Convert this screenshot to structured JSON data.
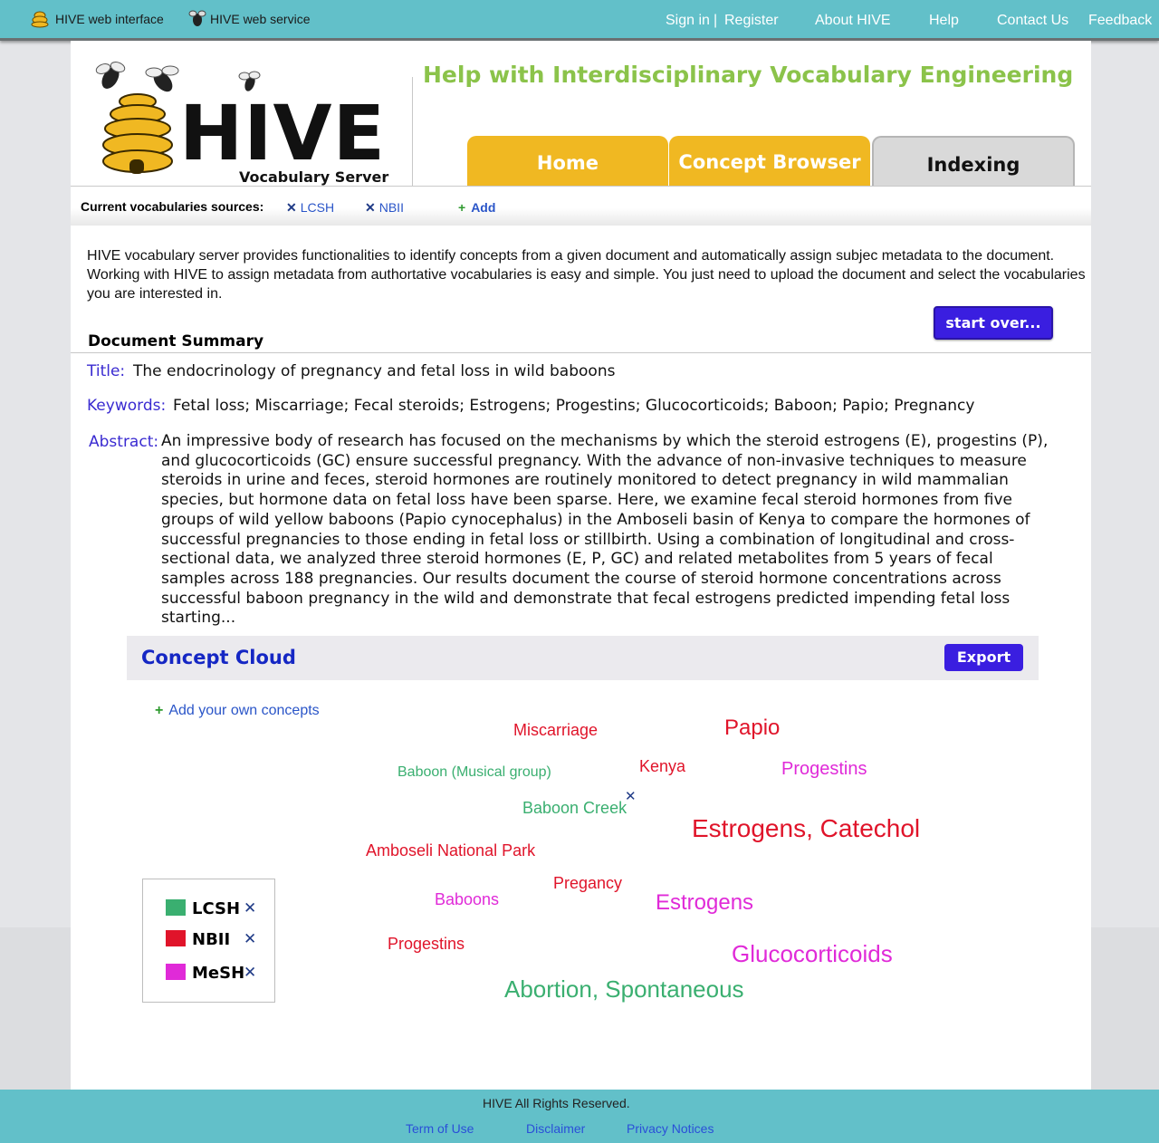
{
  "topbar": {
    "left_links": [
      "HIVE web interface",
      "HIVE web service"
    ],
    "sign_in": "Sign in",
    "sep": "|",
    "register": "Register",
    "about": "About HIVE",
    "help": "Help",
    "contact": "Contact Us",
    "feedback": "Feedback"
  },
  "header": {
    "logo_word": "HIVE",
    "logo_sub": "Vocabulary Server",
    "tagline": "Help with Interdisciplinary Vocabulary Engineering",
    "tabs": [
      "Home",
      "Concept Browser",
      "Indexing"
    ],
    "active_tab": "Indexing"
  },
  "sources": {
    "label": "Current vocabularies sources:",
    "items": [
      "LCSH",
      "NBII"
    ],
    "add": "Add",
    "remove_glyph": "✕",
    "add_glyph": "+"
  },
  "intro": "HIVE vocabulary server provides functionalities to identify concepts from a given document and automatically assign subjec metadata to the document. Working with HIVE to assign metadata from authortative vocabularies is easy and simple. You just need to upload the document and select the vocabularies you are interested in.",
  "start_over": "start over...",
  "summary": {
    "heading": "Document Summary",
    "title_label": "Title:",
    "title": "The endocrinology of pregnancy and fetal loss in wild baboons",
    "keywords_label": "Keywords:",
    "keywords": "Fetal loss; Miscarriage; Fecal steroids; Estrogens; Progestins; Glucocorticoids; Baboon; Papio; Pregnancy",
    "abstract_label": "Abstract:",
    "abstract": "An impressive body of research has focused on the mechanisms by which the steroid estrogens (E), progestins (P), and glucocorticoids (GC) ensure successful pregnancy. With the advance of non-invasive techniques to measure steroids in urine and feces, steroid hormones are routinely monitored to detect pregnancy in wild mammalian species, but hormone data on fetal loss have been sparse. Here, we examine fecal steroid hormones from five groups of wild yellow baboons (Papio cynocephalus) in the Amboseli basin of Kenya to compare the hormones of successful pregnancies to those ending in fetal loss or stillbirth. Using a combination of longitudinal and cross-sectional data, we analyzed three steroid hormones (E, P, GC) and related metabolites from 5 years of fecal samples across 188 pregnancies. Our results document the course of steroid hormone concentrations across successful baboon pregnancy in the wild and demonstrate that fecal estrogens predicted impending fetal loss starting..."
  },
  "concept_cloud": {
    "title": "Concept Cloud",
    "export": "Export",
    "add_own": "Add your own concepts",
    "remove_glyph": "✕",
    "concepts": [
      {
        "text": "Miscarriage",
        "vocab": "NBII"
      },
      {
        "text": "Papio",
        "vocab": "NBII"
      },
      {
        "text": "Kenya",
        "vocab": "NBII"
      },
      {
        "text": "Baboon (Musical group)",
        "vocab": "LCSH"
      },
      {
        "text": "Progestins",
        "vocab": "MeSH"
      },
      {
        "text": "Baboon Creek",
        "vocab": "LCSH"
      },
      {
        "text": "Estrogens, Catechol",
        "vocab": "NBII"
      },
      {
        "text": "Amboseli National Park",
        "vocab": "NBII"
      },
      {
        "text": "Pregancy",
        "vocab": "NBII"
      },
      {
        "text": "Baboons",
        "vocab": "MeSH"
      },
      {
        "text": "Estrogens",
        "vocab": "MeSH"
      },
      {
        "text": "Progestins",
        "vocab": "NBII"
      },
      {
        "text": "Glucocorticoids",
        "vocab": "MeSH"
      },
      {
        "text": "Abortion, Spontaneous",
        "vocab": "LCSH"
      }
    ],
    "legend": [
      {
        "label": "LCSH",
        "color": "#3aaf70"
      },
      {
        "label": "NBII",
        "color": "#e0142a"
      },
      {
        "label": "MeSH",
        "color": "#e02ad8"
      }
    ]
  },
  "footer": {
    "copyright": "HIVE All Rights Reserved.",
    "links": [
      "Term of Use",
      "Disclaimer",
      "Privacy Notices"
    ]
  },
  "colors": {
    "topbar": "#62c0c9",
    "tab_yellow": "#f0b822",
    "tagline": "#8bc34a",
    "button": "#3a1ee0"
  }
}
